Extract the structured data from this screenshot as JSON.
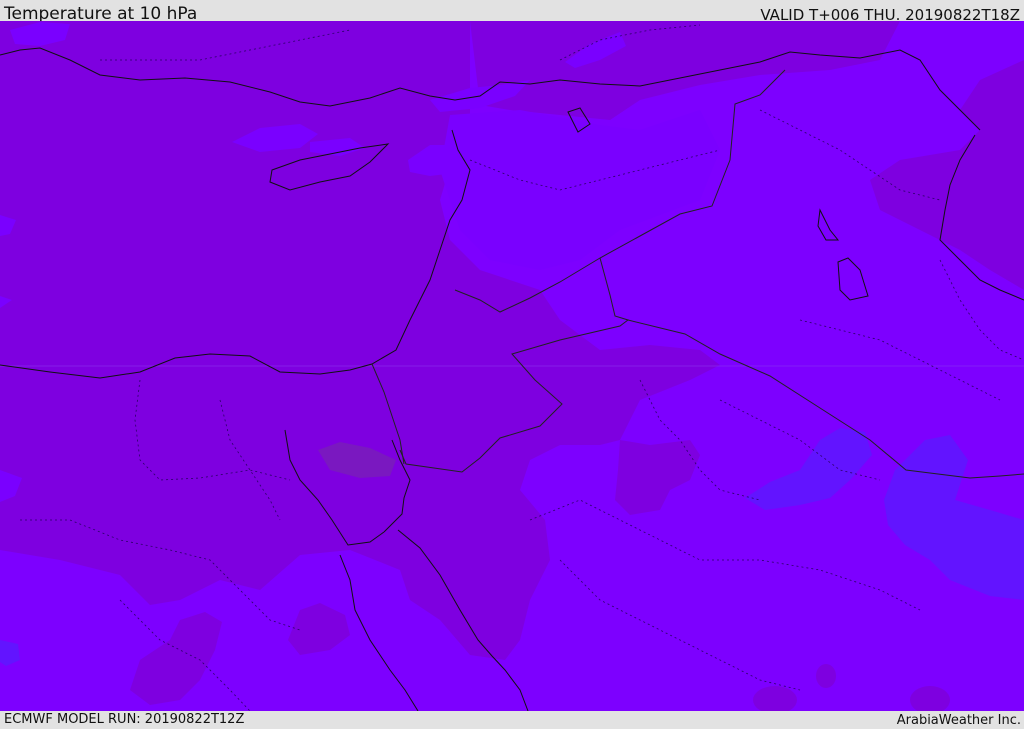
{
  "header": {
    "title": "Temperature at 10 hPa",
    "valid": "VALID T+006 THU. 20190822T18Z"
  },
  "footer": {
    "model_run": "ECMWF MODEL RUN: 20190822T12Z",
    "credit": "ArabiaWeather Inc."
  },
  "colors": {
    "bar_background": "#e2e2e2",
    "fill_darker": "#7e00e0",
    "fill_base": "#7d00ff",
    "fill_light": "#7a00ff",
    "fill_coolest": "#6214ff",
    "fill_warmest": "#7a18c0",
    "coastline": "#111111",
    "border": "#222222"
  },
  "icons": {
    "map": "weather-map"
  }
}
